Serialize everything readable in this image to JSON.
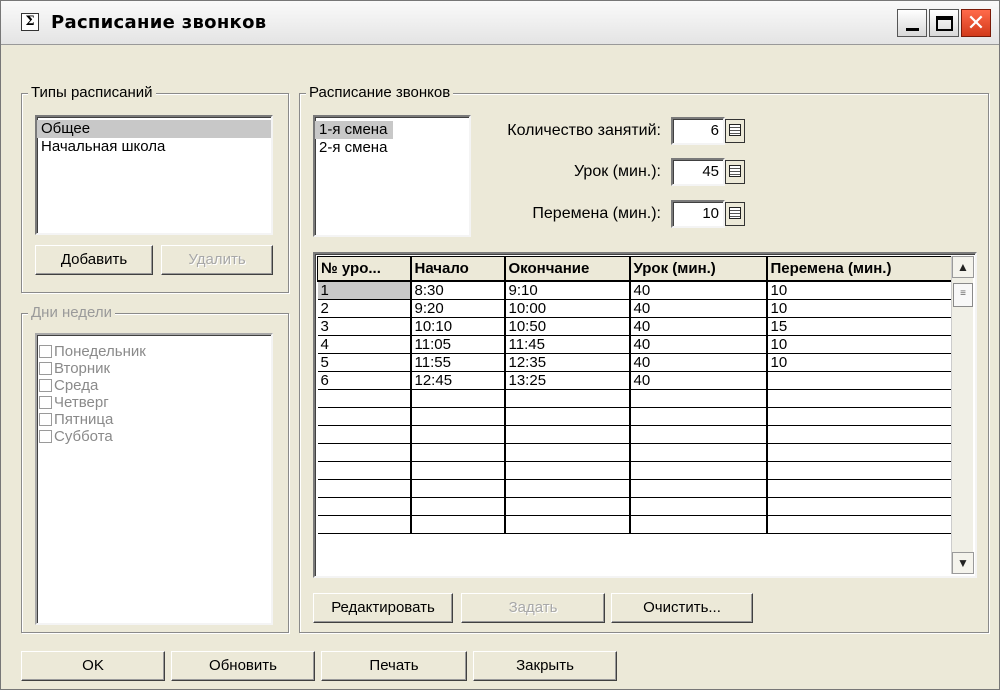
{
  "window": {
    "title": "Расписание звонков",
    "close_glyph": "✕"
  },
  "types_group": {
    "legend": "Типы расписаний",
    "items": [
      "Общее",
      "Начальная школа"
    ],
    "selected_index": 0,
    "add_button": "Добавить",
    "delete_button": "Удалить"
  },
  "days_group": {
    "legend": "Дни недели",
    "days": [
      "Понедельник",
      "Вторник",
      "Среда",
      "Четверг",
      "Пятница",
      "Суббота"
    ]
  },
  "schedule_group": {
    "legend": "Расписание звонков",
    "shifts": [
      "1-я смена",
      "2-я смена"
    ],
    "selected_shift_index": 0,
    "lessons_count_label": "Количество занятий:",
    "lessons_count": "6",
    "lesson_min_label": "Урок (мин.):",
    "lesson_min": "45",
    "break_min_label": "Перемена (мин.):",
    "break_min": "10"
  },
  "grid": {
    "columns": [
      "№ уро...",
      "Начало",
      "Окончание",
      "Урок (мин.)",
      "Перемена (мин.)"
    ],
    "rows": [
      [
        "1",
        "8:30",
        "9:10",
        "40",
        "10"
      ],
      [
        "2",
        "9:20",
        "10:00",
        "40",
        "10"
      ],
      [
        "3",
        "10:10",
        "10:50",
        "40",
        "15"
      ],
      [
        "4",
        "11:05",
        "11:45",
        "40",
        "10"
      ],
      [
        "5",
        "11:55",
        "12:35",
        "40",
        "10"
      ],
      [
        "6",
        "12:45",
        "13:25",
        "40",
        ""
      ],
      [
        "",
        "",
        "",
        "",
        ""
      ],
      [
        "",
        "",
        "",
        "",
        ""
      ],
      [
        "",
        "",
        "",
        "",
        ""
      ],
      [
        "",
        "",
        "",
        "",
        ""
      ],
      [
        "",
        "",
        "",
        "",
        ""
      ],
      [
        "",
        "",
        "",
        "",
        ""
      ],
      [
        "",
        "",
        "",
        "",
        ""
      ],
      [
        "",
        "",
        "",
        "",
        ""
      ]
    ],
    "scroll_up_glyph": "▲",
    "scroll_down_glyph": "▼",
    "scroll_thumb_glyph": "≡"
  },
  "actions": {
    "edit_button": "Редактировать",
    "set_button": "Задать",
    "clear_button": "Очистить..."
  },
  "bottom": {
    "ok_button": "OK",
    "refresh_button": "Обновить",
    "print_button": "Печать",
    "close_button": "Закрыть"
  },
  "colors": {
    "window_bg": "#ece9d8",
    "selection": "#c8c8c8",
    "disabled_text": "#9a9a9a",
    "close_button": "#d23a1a"
  }
}
